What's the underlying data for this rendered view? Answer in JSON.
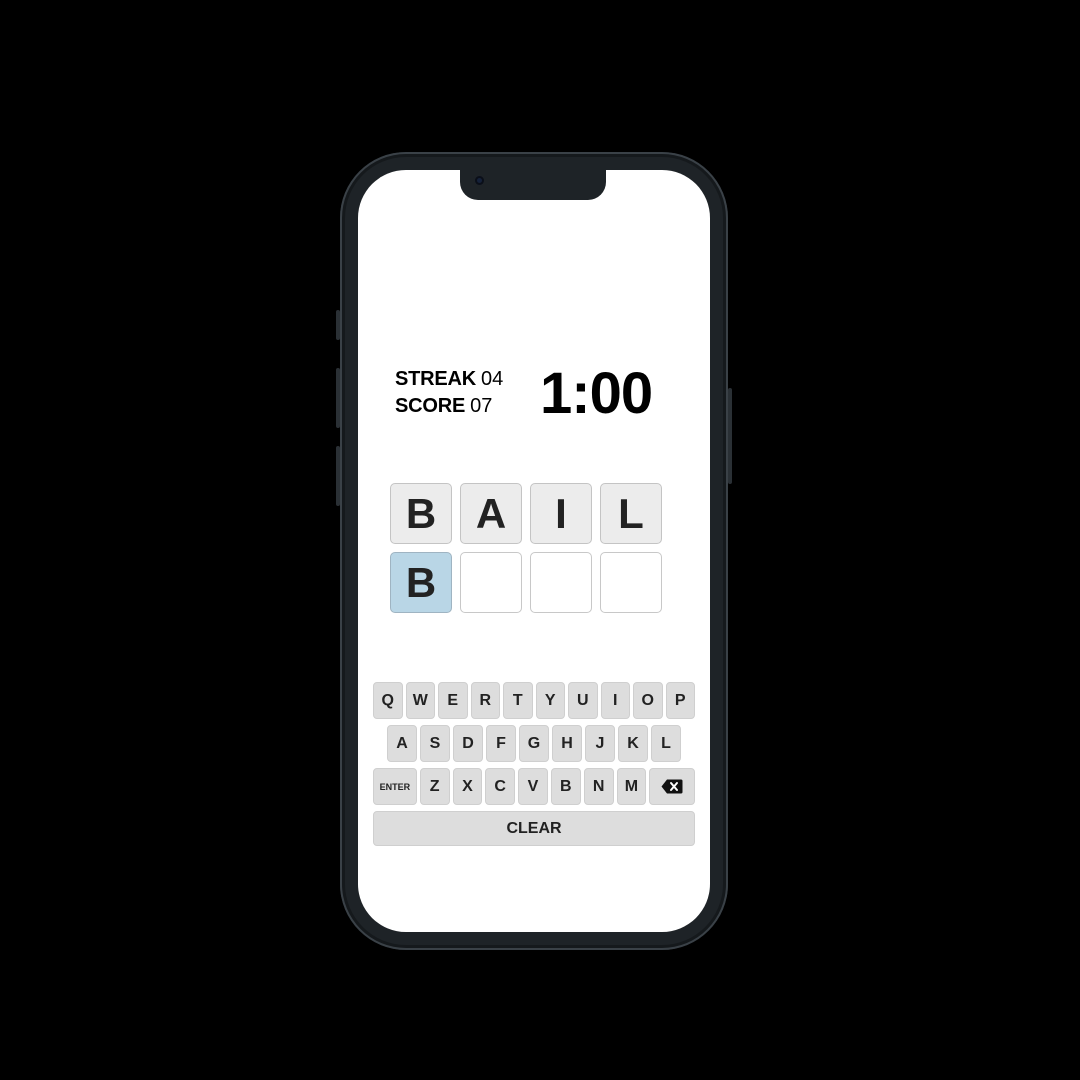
{
  "stats": {
    "streak_label": "STREAK",
    "streak_value": "04",
    "score_label": "SCORE",
    "score_value": "07"
  },
  "timer": "1:00",
  "target_word": [
    "B",
    "A",
    "I",
    "L"
  ],
  "guess": [
    "B",
    "",
    "",
    ""
  ],
  "keyboard": {
    "row1": [
      "Q",
      "W",
      "E",
      "R",
      "T",
      "Y",
      "U",
      "I",
      "O",
      "P"
    ],
    "row2": [
      "A",
      "S",
      "D",
      "F",
      "G",
      "H",
      "J",
      "K",
      "L"
    ],
    "row3_enter": "ENTER",
    "row3": [
      "Z",
      "X",
      "C",
      "V",
      "B",
      "N",
      "M"
    ],
    "backspace_icon": "backspace-icon",
    "clear": "CLEAR"
  },
  "colors": {
    "active_tile": "#b9d6e6",
    "filled_tile": "#ececec",
    "key_bg": "#dddddd"
  }
}
